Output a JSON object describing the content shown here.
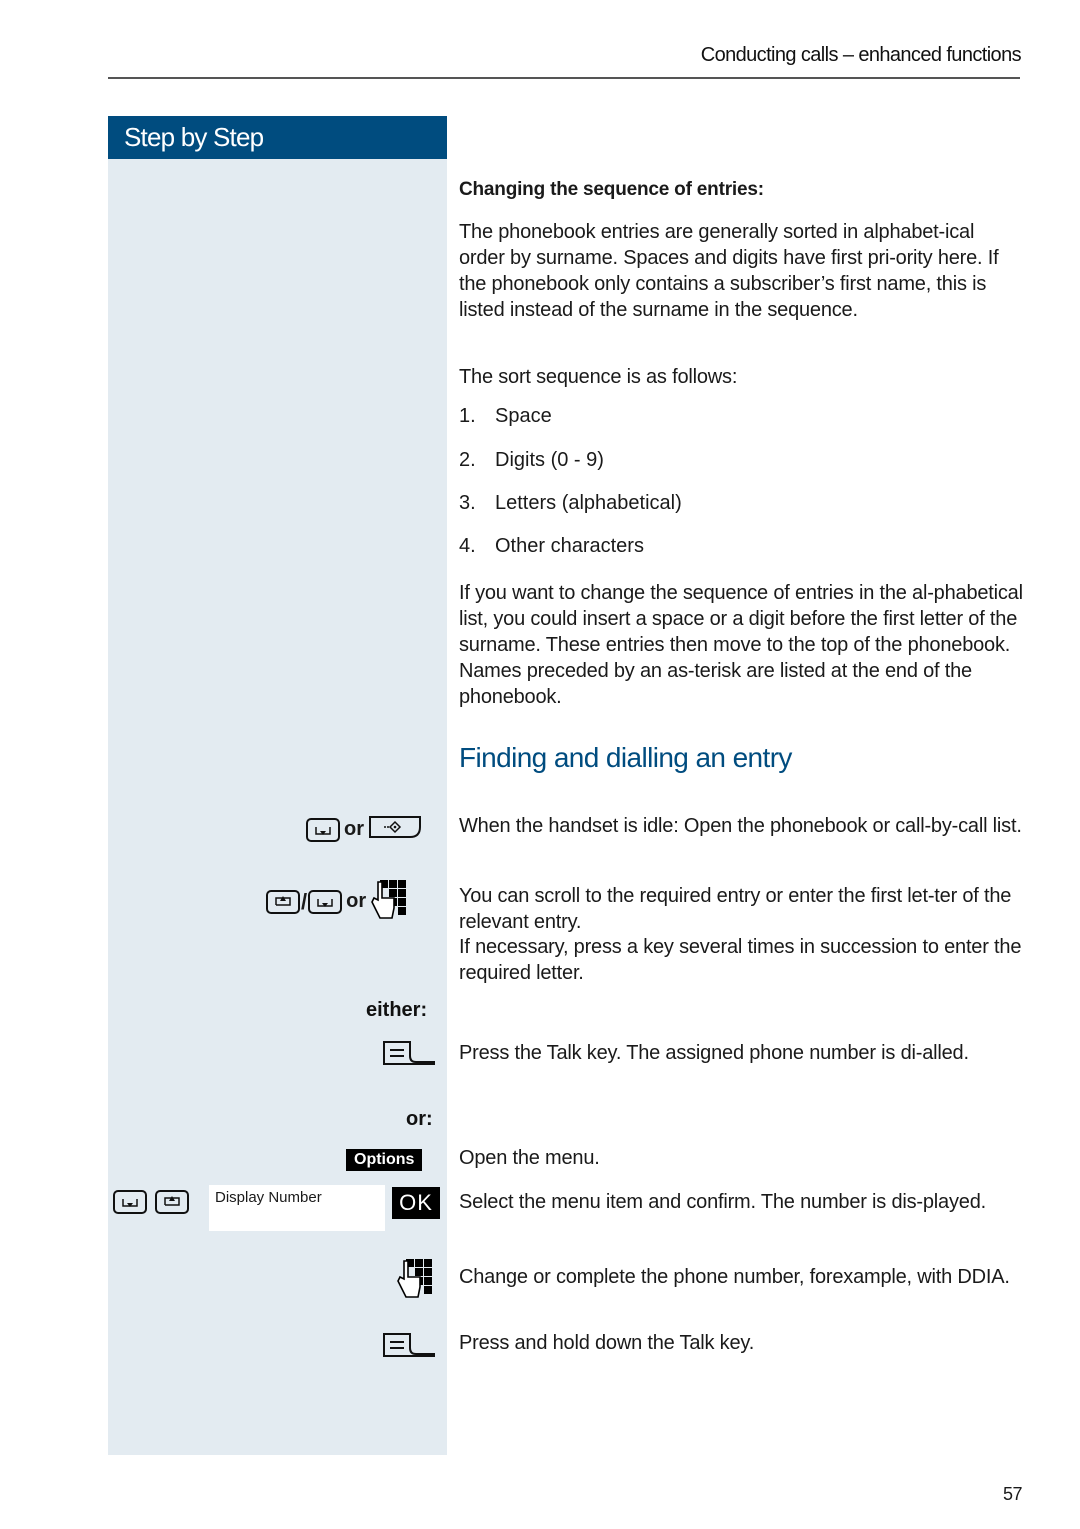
{
  "header": {
    "title": "Conducting calls – enhanced functions"
  },
  "sidebar": {
    "title": "Step by Step",
    "either_label": "either:",
    "or_label": "or:",
    "or_word": "or",
    "slash": "/",
    "options_softkey": "Options",
    "display_text": "Display Number",
    "ok_label": "OK"
  },
  "main": {
    "subheading": "Changing the sequence of entries:",
    "para1": "The phonebook entries are generally sorted in alphabet-ical order by surname. Spaces and digits have first pri-ority here. If the phonebook only contains a subscriber’s first name, this is listed instead of the surname in the sequence.",
    "sort_intro": "The sort sequence is as follows:",
    "sort_list": [
      {
        "num": "1.",
        "text": "Space"
      },
      {
        "num": "2.",
        "text": "Digits (0 - 9)"
      },
      {
        "num": "3.",
        "text": "Letters (alphabetical)"
      },
      {
        "num": "4.",
        "text": "Other characters"
      }
    ],
    "para2": "If you want to change the sequence of entries in the al-phabetical list, you could insert a space or a digit before the first letter of the surname. These entries then move to the top of the phonebook. Names preceded by an as-terisk are listed at the end of the phonebook.",
    "section_title": "Finding and dialling an entry",
    "steps": [
      "When the handset is idle: Open the phonebook or call-by-call list.",
      "You can scroll to the required entry or enter the first let-ter of the relevant entry.",
      "If necessary, press a key several times in succession to enter the required letter.",
      "Press the Talk key. The assigned phone number is di-alled.",
      "Open the menu.",
      "Select the menu item and confirm. The number is dis-played.",
      "Change or complete the phone number, forexample, with DDIA.",
      "Press and hold down the Talk key."
    ]
  },
  "footer": {
    "page_number": "57"
  }
}
